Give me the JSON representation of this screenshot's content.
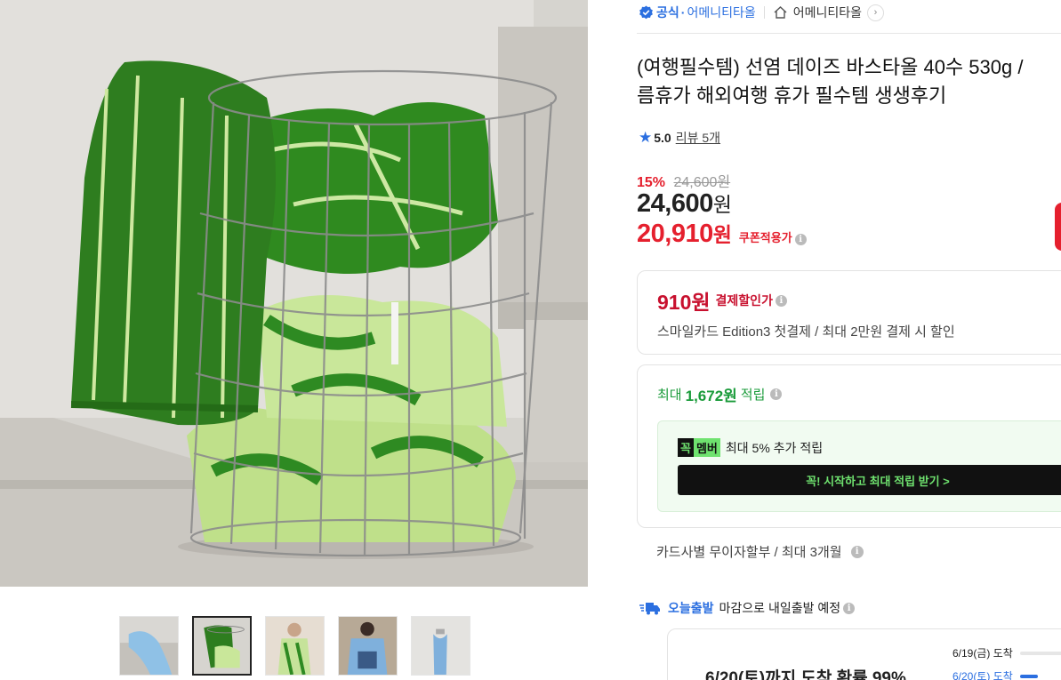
{
  "seller": {
    "official_label": "공식",
    "official_store": "어메니티타올",
    "store_name": "어메니티타올"
  },
  "product": {
    "title_line1": "(여행필수템) 선염 데이즈 바스타올 40수 530g /",
    "title_line2": "름휴가 해외여행 휴가 필수템 생생후기"
  },
  "rating": {
    "score": "5.0",
    "reviews_label": "리뷰 5개"
  },
  "price": {
    "discount_rate": "15%",
    "original_strike": "24,600원",
    "current_num": "24,600",
    "current_unit": "원",
    "coupon_num": "20,910",
    "coupon_unit": "원",
    "coupon_label": "쿠폰적용가"
  },
  "payment_discount": {
    "amount": "910원",
    "label": "결제할인가",
    "description": "스마일카드 Edition3 첫결제 / 최대 2만원 결제 시 할인"
  },
  "points": {
    "prefix": "최대",
    "amount": "1,672원",
    "suffix": "적립",
    "member_logo_a": "꼭",
    "member_logo_b": "멤버",
    "member_text": "최대 5% 추가 적립",
    "member_cta": "꼭! 시작하고 최대 적립 받기 >"
  },
  "installment": "카드사별 무이자할부 / 최대 3개월",
  "shipping": {
    "today_label": "오늘출발",
    "text": "마감으로 내일출발 예정",
    "probability": "6/20(토)까지 도착 확률 99%",
    "dates": [
      {
        "label": "6/19(금) 도착"
      },
      {
        "label": "6/20(토) 도착"
      }
    ]
  },
  "colors": {
    "accent_blue": "#2b6fe0",
    "sale_red": "#e5202e",
    "point_green": "#1a9b3a",
    "towel_green": "#2e7d1f"
  },
  "thumbnails": [
    {
      "name": "thumb-blue-towel"
    },
    {
      "name": "thumb-green-basket"
    },
    {
      "name": "thumb-green-towel-model"
    },
    {
      "name": "thumb-blue-towel-model"
    },
    {
      "name": "thumb-towel-hook"
    }
  ]
}
